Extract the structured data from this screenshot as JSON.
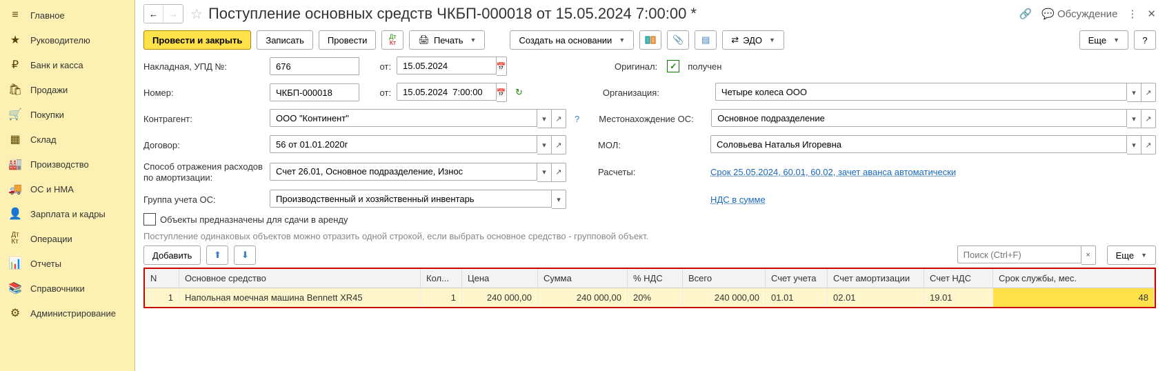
{
  "sidebar": {
    "items": [
      {
        "icon": "menu",
        "label": "Главное"
      },
      {
        "icon": "star",
        "label": "Руководителю"
      },
      {
        "icon": "ruble",
        "label": "Банк и касса"
      },
      {
        "icon": "bag",
        "label": "Продажи"
      },
      {
        "icon": "cart",
        "label": "Покупки"
      },
      {
        "icon": "boxes",
        "label": "Склад"
      },
      {
        "icon": "factory",
        "label": "Производство"
      },
      {
        "icon": "truck",
        "label": "ОС и НМА"
      },
      {
        "icon": "person",
        "label": "Зарплата и кадры"
      },
      {
        "icon": "ops",
        "label": "Операции"
      },
      {
        "icon": "reports",
        "label": "Отчеты"
      },
      {
        "icon": "books",
        "label": "Справочники"
      },
      {
        "icon": "gear",
        "label": "Администрирование"
      }
    ]
  },
  "header": {
    "title": "Поступление основных средств ЧКБП-000018 от 15.05.2024 7:00:00 *",
    "discuss": "Обсуждение"
  },
  "toolbar": {
    "post_close": "Провести и закрыть",
    "save": "Записать",
    "post": "Провести",
    "print": "Печать",
    "create_based": "Создать на основании",
    "edo": "ЭДО",
    "more": "Еще"
  },
  "form": {
    "invoice_label": "Накладная, УПД №:",
    "invoice_no": "676",
    "from_label": "от:",
    "invoice_date": "15.05.2024",
    "original_label": "Оригинал:",
    "original_received": "получен",
    "number_label": "Номер:",
    "number": "ЧКБП-000018",
    "number_date": "15.05.2024  7:00:00",
    "org_label": "Организация:",
    "org": "Четыре колеса ООО",
    "counterparty_label": "Контрагент:",
    "counterparty": "ООО \"Континент\"",
    "location_label": "Местонахождение ОС:",
    "location": "Основное подразделение",
    "contract_label": "Договор:",
    "contract": "56 от 01.01.2020г",
    "mol_label": "МОЛ:",
    "mol": "Соловьева Наталья Игоревна",
    "expense_label": "Способ отражения расходов по амортизации:",
    "expense": "Счет 26.01, Основное подразделение, Износ",
    "calc_label": "Расчеты:",
    "calc_link": "Срок 25.05.2024, 60.01, 60.02, зачет аванса автоматически",
    "group_label": "Группа учета ОС:",
    "group": "Производственный и хозяйственный инвентарь",
    "vat_link": "НДС в сумме",
    "rent_checkbox": "Объекты предназначены для сдачи в аренду",
    "hint": "Поступление одинаковых объектов можно отразить одной строкой, если выбрать основное средство - групповой объект."
  },
  "table_toolbar": {
    "add": "Добавить",
    "search_placeholder": "Поиск (Ctrl+F)",
    "more": "Еще"
  },
  "table": {
    "headers": {
      "n": "N",
      "asset": "Основное средство",
      "qty": "Кол...",
      "price": "Цена",
      "sum": "Сумма",
      "vat_pct": "% НДС",
      "total": "Всего",
      "acc": "Счет учета",
      "amort_acc": "Счет амортизации",
      "vat_acc": "Счет НДС",
      "life": "Срок службы, мес."
    },
    "rows": [
      {
        "n": "1",
        "asset": "Напольная моечная машина Bennett XR45",
        "qty": "1",
        "price": "240 000,00",
        "sum": "240 000,00",
        "vat_pct": "20%",
        "total": "240 000,00",
        "acc": "01.01",
        "amort_acc": "02.01",
        "vat_acc": "19.01",
        "life": "48"
      }
    ]
  }
}
